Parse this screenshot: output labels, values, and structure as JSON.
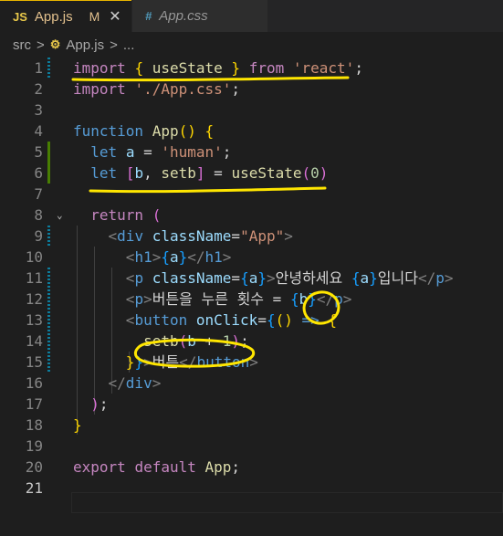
{
  "tabs": [
    {
      "icon": "JS",
      "name": "App.js",
      "status": "M"
    },
    {
      "icon": "#",
      "name": "App.css"
    }
  ],
  "breadcrumb": {
    "folder": "src",
    "sep": ">",
    "file": "App.js",
    "more": "..."
  },
  "editor": {
    "line_numbers": [
      "1",
      "2",
      "3",
      "4",
      "5",
      "6",
      "7",
      "8",
      "9",
      "10",
      "11",
      "12",
      "13",
      "14",
      "15",
      "16",
      "17",
      "18",
      "19",
      "20",
      "21"
    ]
  },
  "colors": {
    "annotation": "#ffe600",
    "accent_tab": "#e8b400"
  }
}
